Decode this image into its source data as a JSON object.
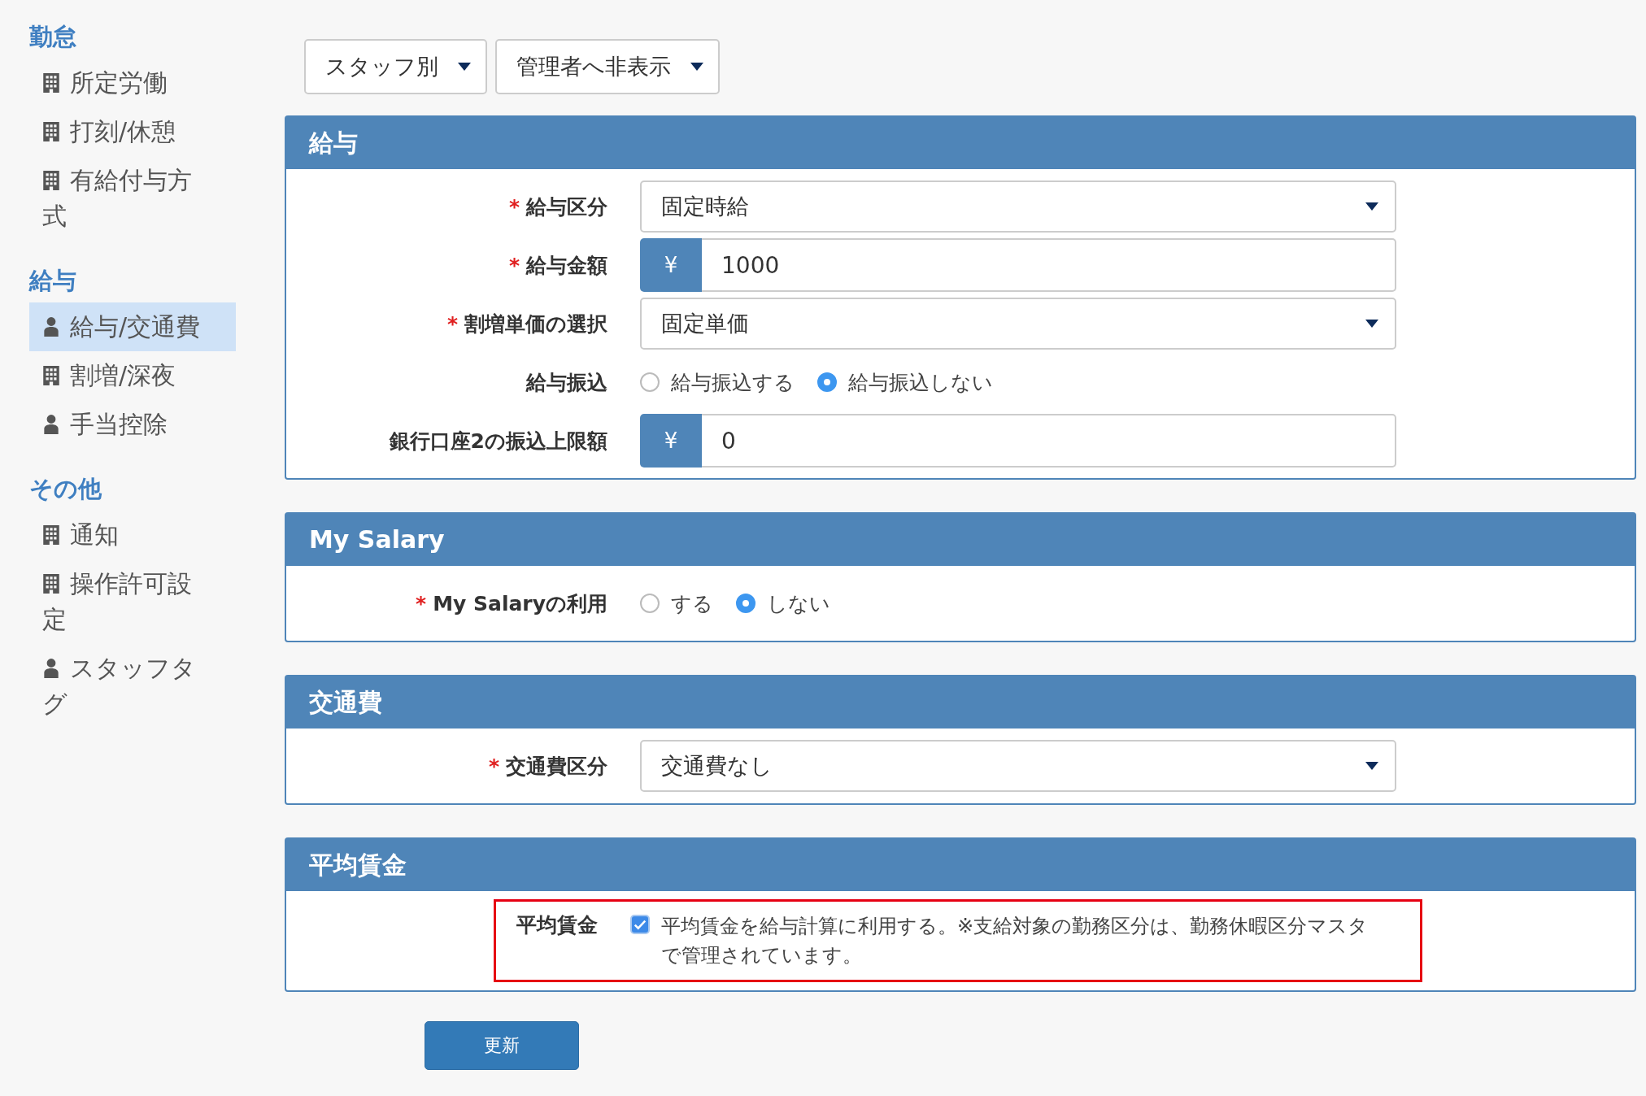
{
  "sidebar": {
    "sections": [
      {
        "title": "勤怠",
        "items": [
          {
            "label": "所定労働",
            "kind": "building",
            "selected": false
          },
          {
            "label": "打刻/休憩",
            "kind": "building",
            "selected": false
          },
          {
            "label": "有給付与方式",
            "kind": "building",
            "selected": false
          }
        ]
      },
      {
        "title": "給与",
        "items": [
          {
            "label": "給与/交通費",
            "kind": "person",
            "selected": true
          },
          {
            "label": "割増/深夜",
            "kind": "building",
            "selected": false
          },
          {
            "label": "手当控除",
            "kind": "person",
            "selected": false
          }
        ]
      },
      {
        "title": "その他",
        "items": [
          {
            "label": "通知",
            "kind": "building",
            "selected": false
          },
          {
            "label": "操作許可設定",
            "kind": "building",
            "selected": false
          },
          {
            "label": "スタッフタグ",
            "kind": "person",
            "selected": false
          }
        ]
      }
    ]
  },
  "filters": [
    {
      "value": "スタッフ別"
    },
    {
      "value": "管理者へ非表示"
    }
  ],
  "panels": [
    {
      "title": "給与",
      "rows": [
        {
          "kind": "select",
          "label": "給与区分",
          "required_mark": "*",
          "value": "固定時給"
        },
        {
          "kind": "currency",
          "label": "給与金額",
          "required_mark": "*",
          "addon": "¥",
          "value": "1000"
        },
        {
          "kind": "select",
          "label": "割増単価の選択",
          "required_mark": "*",
          "value": "固定単価"
        },
        {
          "kind": "radio",
          "label": "給与振込",
          "options": [
            {
              "label": "給与振込する",
              "selected": false
            },
            {
              "label": "給与振込しない",
              "selected": true
            }
          ]
        },
        {
          "kind": "currency",
          "label": "銀行口座2の振込上限額",
          "addon": "¥",
          "value": "0"
        }
      ]
    },
    {
      "title": "My Salary",
      "rows": [
        {
          "kind": "radio",
          "label": "My Salaryの利用",
          "required_mark": "*",
          "options": [
            {
              "label": "する",
              "selected": false
            },
            {
              "label": "しない",
              "selected": true
            }
          ]
        }
      ]
    },
    {
      "title": "交通費",
      "rows": [
        {
          "kind": "select",
          "label": "交通費区分",
          "required_mark": "*",
          "value": "交通費なし"
        }
      ]
    },
    {
      "title": "平均賃金",
      "rows": [
        {
          "kind": "checkbox",
          "label": "平均賃金",
          "highlighted": true,
          "checked": true,
          "text": "平均賃金を給与計算に利用する。※支給対象の勤務区分は、勤務休暇区分マスタで管理されています。"
        }
      ]
    }
  ],
  "submit": "更新"
}
